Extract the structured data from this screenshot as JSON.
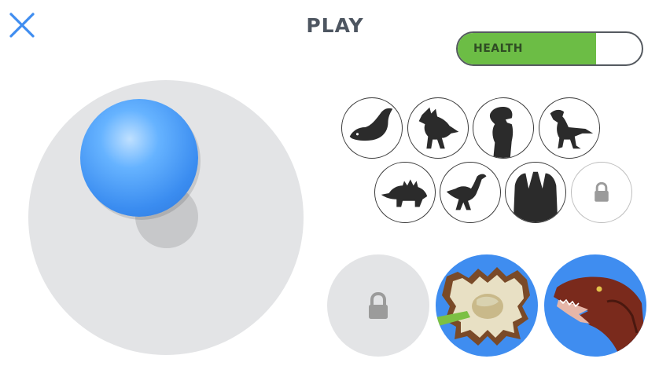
{
  "header": {
    "close_icon": "close-icon",
    "title": "PLAY"
  },
  "health": {
    "label": "HEALTH",
    "level_fraction": 0.75,
    "fill_color": "#6cbd45"
  },
  "joystick": {
    "knob_color": "#3a8cf0",
    "base_color": "#e3e4e6"
  },
  "dino_selector": [
    {
      "icon": "dinosaur-head-icon",
      "locked": false
    },
    {
      "icon": "dilophosaurus-icon",
      "locked": false
    },
    {
      "icon": "t-rex-icon",
      "locked": false
    },
    {
      "icon": "raptor-icon",
      "locked": false
    },
    {
      "icon": "stegosaurus-icon",
      "locked": false
    },
    {
      "icon": "compsognathus-icon",
      "locked": false
    },
    {
      "icon": "dinosaur-footprint-icon",
      "locked": false
    },
    {
      "icon": "lock-icon",
      "locked": true
    }
  ],
  "actions": [
    {
      "icon": "lock-icon",
      "locked": true
    },
    {
      "icon": "dilophosaurus-frill-photo",
      "locked": false
    },
    {
      "icon": "velociraptor-head-photo",
      "locked": false
    }
  ],
  "colors": {
    "accent_blue": "#3f8df0",
    "photo_background": "#3f8df0",
    "text_dark": "#4e5661"
  }
}
